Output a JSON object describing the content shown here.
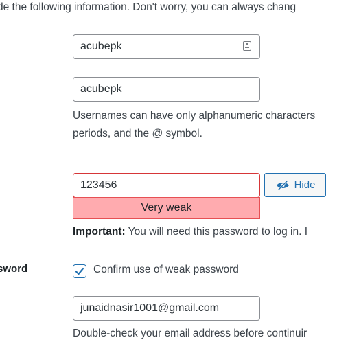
{
  "intro_text": "de the following information. Don't worry, you can always chang",
  "username_field": {
    "value": "acubepk",
    "icon": "keyboard-icon"
  },
  "nickname_field": {
    "value": "acubepk"
  },
  "username_help": {
    "line1": "Usernames can have only alphanumeric characters",
    "line2": "periods, and the @ symbol."
  },
  "password": {
    "value": "123456",
    "strength": "Very weak",
    "hide_button": "Hide",
    "important_label": "Important:",
    "important_text": " You will need this password to log in. I"
  },
  "confirm_weak": {
    "label_cut": "sword",
    "checkbox_label": "Confirm use of weak password",
    "checked": true
  },
  "email": {
    "value": "junaidnasir1001@gmail.com",
    "help": "Double-check your email address before continuir"
  },
  "colors": {
    "accent": "#2271b1",
    "weak_bg": "#ffabaf",
    "weak_border": "#d63638"
  }
}
